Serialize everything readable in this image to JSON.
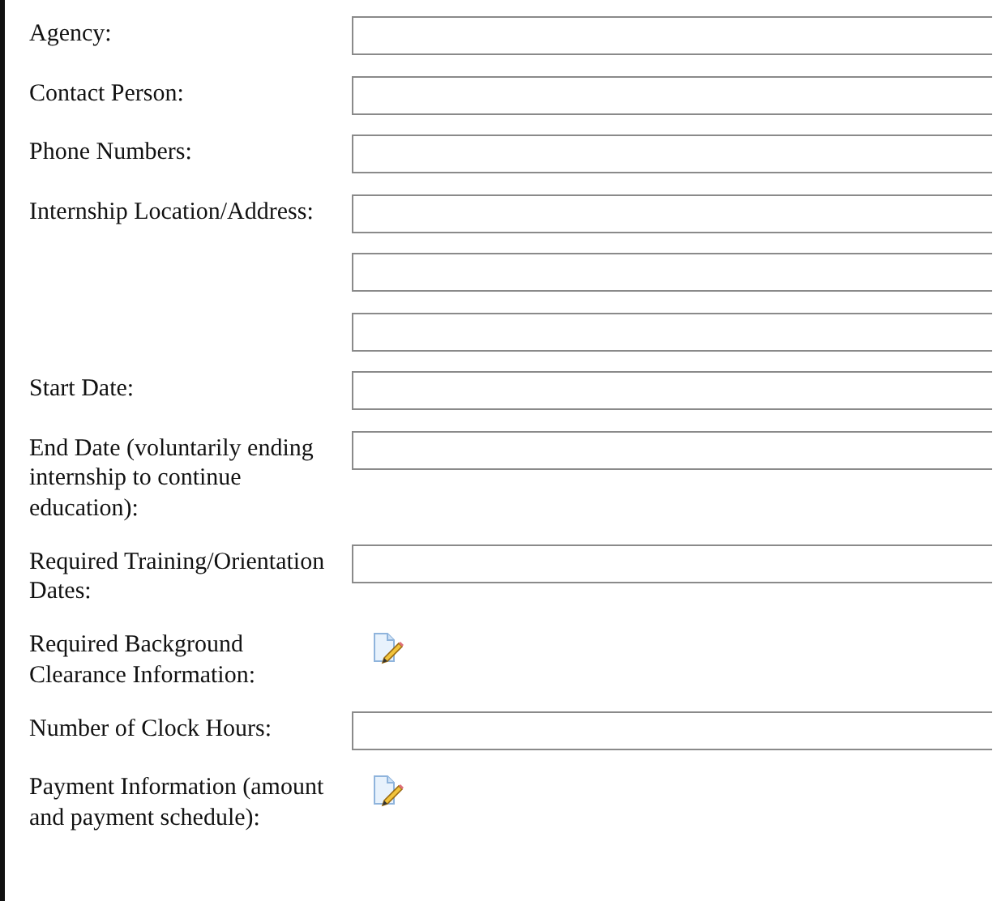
{
  "rows": [
    {
      "label": "Agency:",
      "kind": "field"
    },
    {
      "label": "Contact Person:",
      "kind": "field"
    },
    {
      "label": "Phone Numbers:",
      "kind": "field"
    },
    {
      "label": "Internship Location/Address:",
      "kind": "field"
    },
    {
      "kind": "field"
    },
    {
      "kind": "field"
    },
    {
      "label": "Start Date:",
      "kind": "field"
    },
    {
      "label": "End Date (voluntarily ending internship to continue education):",
      "kind": "field"
    },
    {
      "label": "Required Training/Orientation Dates:",
      "kind": "field"
    },
    {
      "label": "Required Background Clearance Information:",
      "kind": "note"
    },
    {
      "label": "Number of Clock Hours:",
      "kind": "field"
    },
    {
      "label": "Payment Information (amount and payment schedule):",
      "kind": "note"
    }
  ]
}
